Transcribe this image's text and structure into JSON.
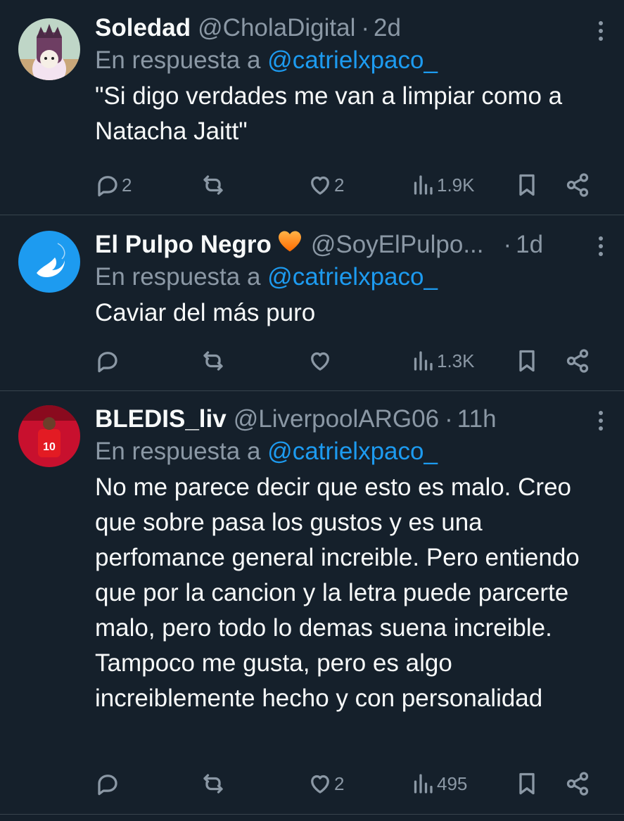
{
  "reply_prefix": "En respuesta a",
  "tweets": [
    {
      "name": "Soledad",
      "handle": "@CholaDigital",
      "separator": "·",
      "time": "2d",
      "mention": "@catrielxpaco_",
      "text": "\"Si digo verdades me van a limpiar como a Natacha Jaitt\"",
      "replies": "2",
      "retweets": "",
      "likes": "2",
      "views": "1.9K"
    },
    {
      "name": "El Pulpo Negro",
      "name_emoji": "orange-heart-icon",
      "handle": "@SoyElPulpo...",
      "separator": "·",
      "time": "1d",
      "mention": "@catrielxpaco_",
      "text": "Caviar del más puro",
      "replies": "",
      "retweets": "",
      "likes": "",
      "views": "1.3K"
    },
    {
      "name": "BLEDIS_liv",
      "handle": "@LiverpoolARG06",
      "separator": "·",
      "time": "11h",
      "mention": "@catrielxpaco_",
      "text": "No me parece decir que esto es malo. Creo que sobre pasa los gustos y es una perfomance general increible. Pero entiendo que por la cancion y la letra puede parcerte malo, pero todo lo demas suena increible. Tampoco me gusta, pero es algo increiblemente hecho y con personalidad",
      "replies": "",
      "retweets": "",
      "likes": "2",
      "views": "495",
      "avatar_text": "10"
    }
  ],
  "colors": {
    "background": "#15202b",
    "secondary_text": "#8b98a5",
    "link": "#1d9bf0",
    "divider": "#38444d"
  }
}
